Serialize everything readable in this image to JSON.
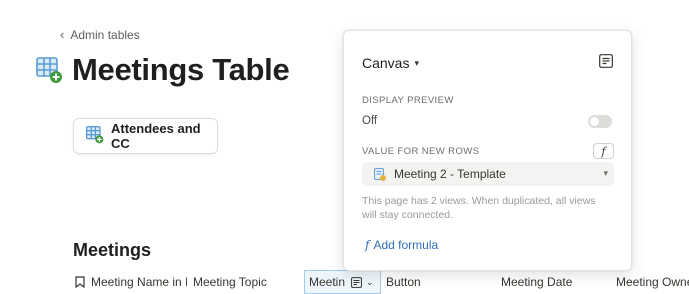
{
  "breadcrumb": {
    "label": "Admin tables"
  },
  "page": {
    "title": "Meetings Table"
  },
  "linked_view": {
    "label": "Attendees and CC"
  },
  "section": {
    "title": "Meetings"
  },
  "columns": [
    {
      "label": "Meeting Name in I"
    },
    {
      "label": "Meeting Topic"
    },
    {
      "label": "Meetin"
    },
    {
      "label": "Button"
    },
    {
      "label": "Meeting Date"
    },
    {
      "label": "Meeting Owne"
    }
  ],
  "popup": {
    "view_name": "Canvas",
    "display_preview_label": "DISPLAY PREVIEW",
    "display_preview_value": "Off",
    "value_label": "VALUE FOR NEW ROWS",
    "template_value": "Meeting 2 - Template",
    "note": "This page has 2 views. When duplicated, all views will stay connected.",
    "add_formula_label": "Add formula"
  },
  "colors": {
    "accent": "#2f6fb6",
    "db_icon": "#5b9bd5",
    "plus_badge": "#3c9a3c"
  }
}
